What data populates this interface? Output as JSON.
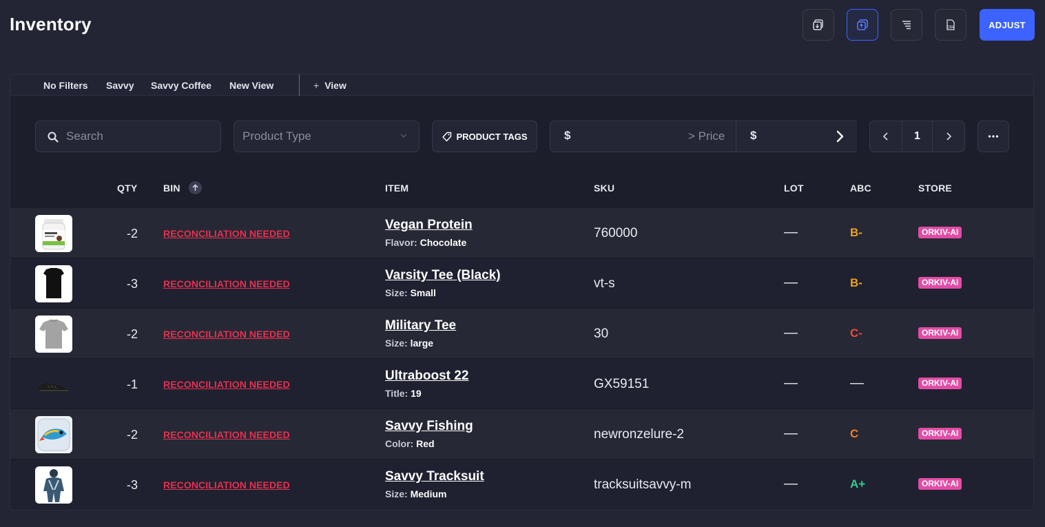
{
  "page": {
    "title": "Inventory"
  },
  "header": {
    "buttons": [
      {
        "name": "import-icon"
      },
      {
        "name": "copy-icon"
      },
      {
        "name": "filter-list-icon"
      },
      {
        "name": "csv-icon",
        "text": "CSV"
      }
    ],
    "adjust_label": "ADJUST"
  },
  "views": {
    "tabs": [
      "No Filters",
      "Savvy",
      "Savvy Coffee",
      "New View"
    ],
    "add_label": "View"
  },
  "filters": {
    "search_placeholder": "Search",
    "product_type_placeholder": "Product Type",
    "tags_label": "PRODUCT TAGS",
    "price_min_symbol": "$",
    "price_label": "> Price",
    "price_max_symbol": "$",
    "page": "1"
  },
  "table": {
    "columns": {
      "qty": "QTY",
      "bin": "BIN",
      "item": "ITEM",
      "sku": "SKU",
      "lot": "LOT",
      "abc": "ABC",
      "store": "STORE"
    },
    "rows": [
      {
        "qty": "-2",
        "bin": "RECONCILIATION NEEDED",
        "name": "Vegan Protein",
        "opt_key": "Flavor:",
        "opt_val": "Chocolate",
        "sku": "760000",
        "lot": "—",
        "abc": "B-",
        "store": "ORKIV-AI"
      },
      {
        "qty": "-3",
        "bin": "RECONCILIATION NEEDED",
        "name": "Varsity Tee (Black)",
        "opt_key": "Size:",
        "opt_val": "Small",
        "sku": "vt-s",
        "lot": "—",
        "abc": "B-",
        "store": "ORKIV-AI"
      },
      {
        "qty": "-2",
        "bin": "RECONCILIATION NEEDED",
        "name": "Military Tee",
        "opt_key": "Size:",
        "opt_val": "large",
        "sku": "30",
        "lot": "—",
        "abc": "C-",
        "store": "ORKIV-AI"
      },
      {
        "qty": "-1",
        "bin": "RECONCILIATION NEEDED",
        "name": "Ultraboost 22",
        "opt_key": "Title:",
        "opt_val": "19",
        "sku": "GX59151",
        "lot": "—",
        "abc": "—",
        "store": "ORKIV-AI"
      },
      {
        "qty": "-2",
        "bin": "RECONCILIATION NEEDED",
        "name": "Savvy Fishing",
        "opt_key": "Color:",
        "opt_val": "Red",
        "sku": "newronzelure-2",
        "lot": "—",
        "abc": "C",
        "store": "ORKIV-AI"
      },
      {
        "qty": "-3",
        "bin": "RECONCILIATION NEEDED",
        "name": "Savvy Tracksuit",
        "opt_key": "Size:",
        "opt_val": "Medium",
        "sku": "tracksuitsavvy-m",
        "lot": "—",
        "abc": "A+",
        "store": "ORKIV-AI"
      }
    ]
  },
  "colors": {
    "accent": "#3c63ff",
    "bin_warning": "#e5304f",
    "store_badge": "#e24ca5",
    "abc_b": "#f0a020",
    "abc_c_minus": "#f04a3a",
    "abc_c": "#f07a2a",
    "abc_a_plus": "#2fcf8a"
  }
}
